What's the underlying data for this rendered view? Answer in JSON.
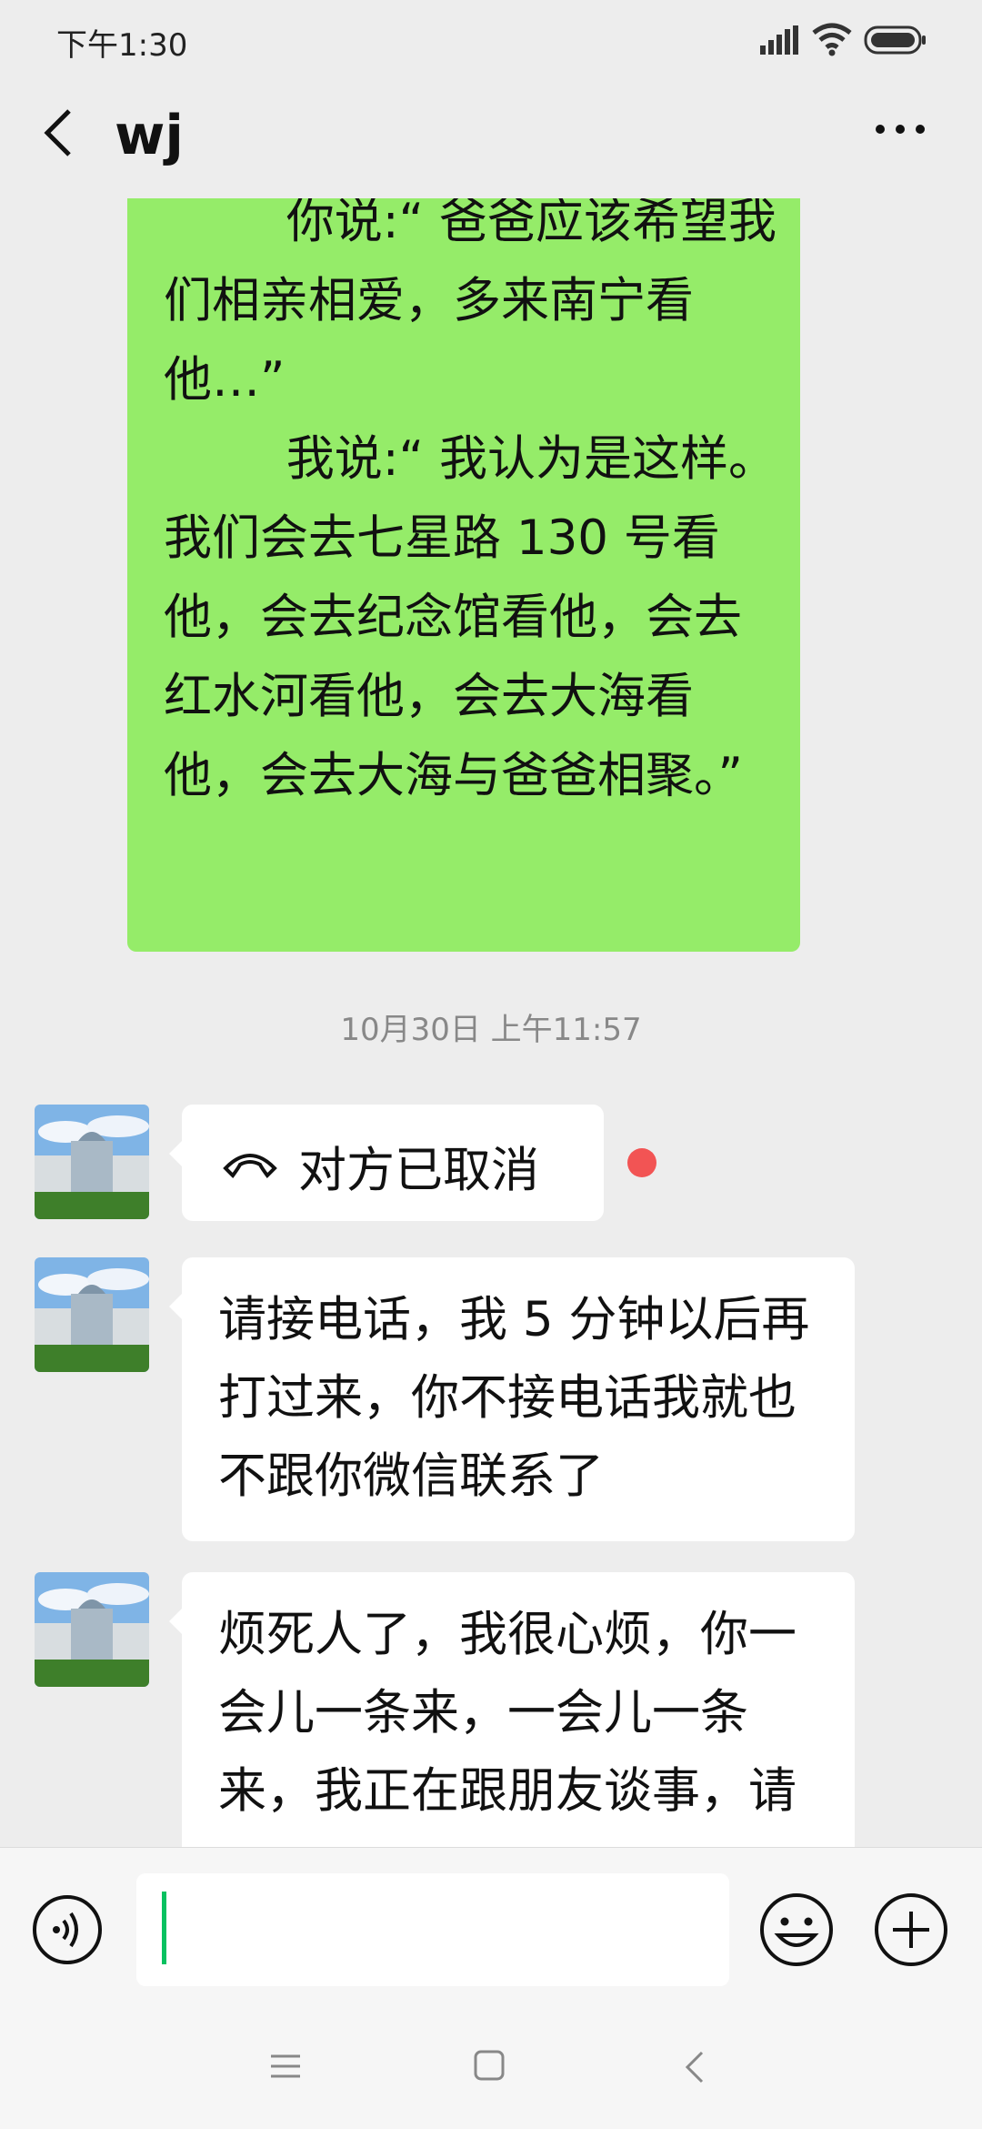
{
  "status_bar": {
    "time": "下午1:30",
    "icons": [
      "signal-icon",
      "wifi-icon",
      "battery-icon"
    ]
  },
  "header": {
    "title": "wj",
    "back_icon": "back-arrow-icon",
    "more_icon": "more-dots-icon"
  },
  "messages": {
    "outgoing_text": "        你说:“ 爸爸应该希望我们相亲相爱，多来南宁看他…”\n        我说:“ 我认为是这样。我们会去七星路 130 号看他，会去纪念馆看他，会去红水河看他，会去大海看他，会去大海与爸爸相聚。”",
    "timestamp": "10月30日 上午11:57",
    "call_status": "对方已取消",
    "incoming_1": "请接电话，我 5 分钟以后再打过来，你不接电话我就也不跟你微信联系了",
    "incoming_2": "烦死人了，我很心烦，你一会儿一条来，一会儿一条来，我正在跟朋友谈事，请"
  },
  "input_bar": {
    "text_value": "",
    "icons": [
      "voice-icon",
      "emoji-icon",
      "plus-icon"
    ]
  },
  "nav_bar": {
    "icons": [
      "menu-icon",
      "home-icon",
      "back-icon"
    ]
  },
  "colors": {
    "outgoing_bubble": "#95ec69",
    "background": "#ededed",
    "unread_dot": "#f25454",
    "caret": "#07c160"
  }
}
